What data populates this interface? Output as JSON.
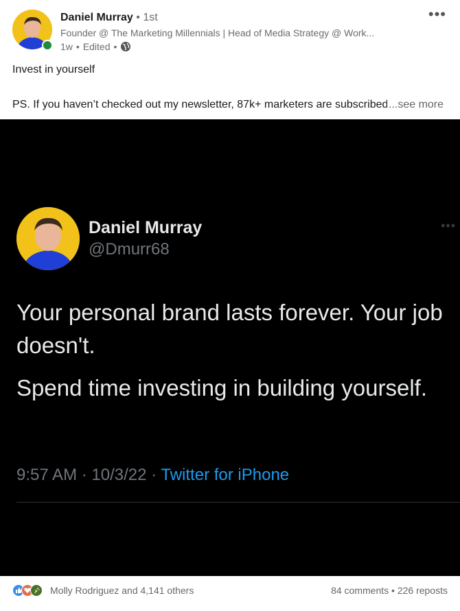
{
  "post": {
    "author_name": "Daniel Murray",
    "connection_sep": "•",
    "connection_degree": "1st",
    "headline": "Founder @ The Marketing Millennials | Head of Media Strategy @ Work...",
    "time": "1w",
    "meta_sep1": "•",
    "edited": "Edited",
    "meta_sep2": "•",
    "visibility_icon": "globe-icon",
    "more_icon": "•••",
    "text": "Invest in yourself",
    "ps_text": "PS. If you haven’t checked out my newsletter, 87k+ marketers are subscribed",
    "see_more": "...see more"
  },
  "tweet": {
    "name": "Daniel Murray",
    "handle": "@Dmurr68",
    "more_icon": "•••",
    "body_line1": "Your personal brand lasts forever. Your job doesn't.",
    "body_line2": "Spend time investing in building yourself.",
    "time": "9:57 AM",
    "sep1": "·",
    "date": "10/3/22",
    "sep2": "·",
    "source": "Twitter for iPhone"
  },
  "footer": {
    "reaction_icons": [
      "like-icon",
      "love-icon",
      "celebrate-icon"
    ],
    "reaction_text": "Molly Rodriguez and 4,141 others",
    "comments": "84 comments",
    "sep": "•",
    "reposts": "226 reposts"
  },
  "colors": {
    "online": "#1f8a3c",
    "avatar_bg": "#f2c21b",
    "tweet_link": "#1d9bf0",
    "like": "#378fe9",
    "love": "#df704d",
    "celebrate": "#44712e"
  }
}
